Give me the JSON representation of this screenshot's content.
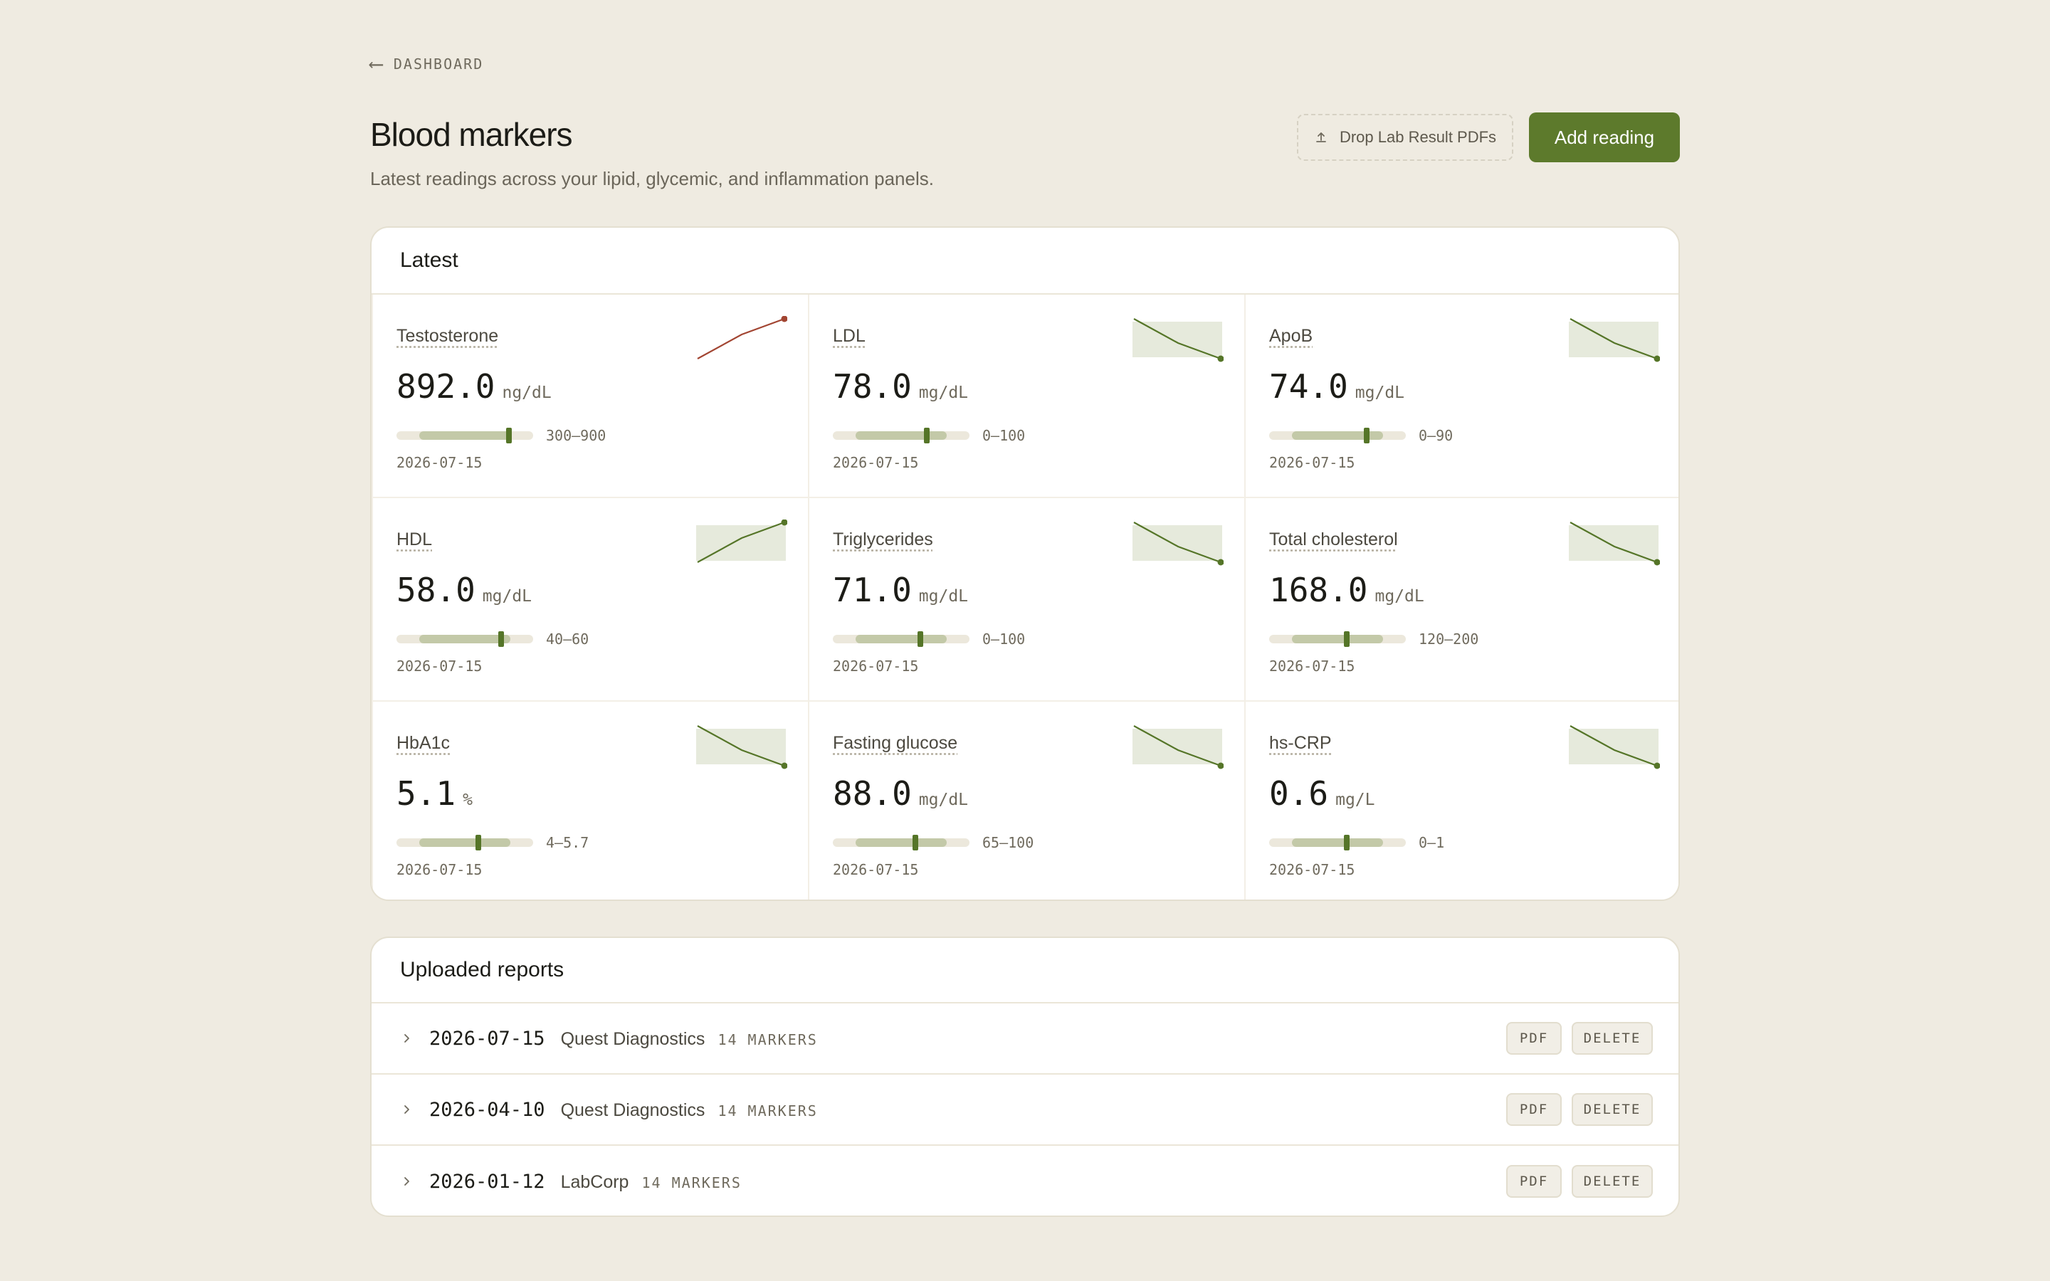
{
  "nav": {
    "back_label": "DASHBOARD"
  },
  "header": {
    "title": "Blood markers",
    "subtitle": "Latest readings across your lipid, glycemic, and inflammation panels.",
    "drop_label": "Drop Lab Result PDFs",
    "add_label": "Add reading"
  },
  "latest": {
    "title": "Latest",
    "markers": [
      {
        "name": "Testosterone",
        "value": "892.0",
        "unit": "ng/dL",
        "range": "300–900",
        "date": "2026-07-15",
        "range_min": 300,
        "range_max": 900,
        "level": 892,
        "trend": "up",
        "trend_color": "#a24532",
        "shade": false
      },
      {
        "name": "LDL",
        "value": "78.0",
        "unit": "mg/dL",
        "range": "0–100",
        "date": "2026-07-15",
        "range_min": 0,
        "range_max": 100,
        "level": 78,
        "trend": "down",
        "trend_color": "#557528",
        "shade": true
      },
      {
        "name": "ApoB",
        "value": "74.0",
        "unit": "mg/dL",
        "range": "0–90",
        "date": "2026-07-15",
        "range_min": 0,
        "range_max": 90,
        "level": 74,
        "trend": "down",
        "trend_color": "#557528",
        "shade": true
      },
      {
        "name": "HDL",
        "value": "58.0",
        "unit": "mg/dL",
        "range": "40–60",
        "date": "2026-07-15",
        "range_min": 40,
        "range_max": 60,
        "level": 58,
        "trend": "up",
        "trend_color": "#557528",
        "shade": true
      },
      {
        "name": "Triglycerides",
        "value": "71.0",
        "unit": "mg/dL",
        "range": "0–100",
        "date": "2026-07-15",
        "range_min": 0,
        "range_max": 100,
        "level": 71,
        "trend": "down",
        "trend_color": "#557528",
        "shade": true
      },
      {
        "name": "Total cholesterol",
        "value": "168.0",
        "unit": "mg/dL",
        "range": "120–200",
        "date": "2026-07-15",
        "range_min": 120,
        "range_max": 200,
        "level": 168,
        "trend": "down",
        "trend_color": "#557528",
        "shade": true
      },
      {
        "name": "HbA1c",
        "value": "5.1",
        "unit": "%",
        "range": "4–5.7",
        "date": "2026-07-15",
        "range_min": 4,
        "range_max": 5.7,
        "level": 5.1,
        "trend": "down",
        "trend_color": "#557528",
        "shade": true
      },
      {
        "name": "Fasting glucose",
        "value": "88.0",
        "unit": "mg/dL",
        "range": "65–100",
        "date": "2026-07-15",
        "range_min": 65,
        "range_max": 100,
        "level": 88,
        "trend": "down",
        "trend_color": "#557528",
        "shade": true
      },
      {
        "name": "hs-CRP",
        "value": "0.6",
        "unit": "mg/L",
        "range": "0–1",
        "date": "2026-07-15",
        "range_min": 0,
        "range_max": 1,
        "level": 0.6,
        "trend": "down",
        "trend_color": "#557528",
        "shade": true
      }
    ]
  },
  "reports": {
    "title": "Uploaded reports",
    "pdf_label": "PDF",
    "delete_label": "DELETE",
    "rows": [
      {
        "date": "2026-07-15",
        "lab": "Quest Diagnostics",
        "count": "14 MARKERS"
      },
      {
        "date": "2026-04-10",
        "lab": "Quest Diagnostics",
        "count": "14 MARKERS"
      },
      {
        "date": "2026-01-12",
        "lab": "LabCorp",
        "count": "14 MARKERS"
      }
    ]
  },
  "colors": {
    "accent": "#5d7a2c",
    "background": "#efebe1",
    "alert": "#a24532"
  }
}
